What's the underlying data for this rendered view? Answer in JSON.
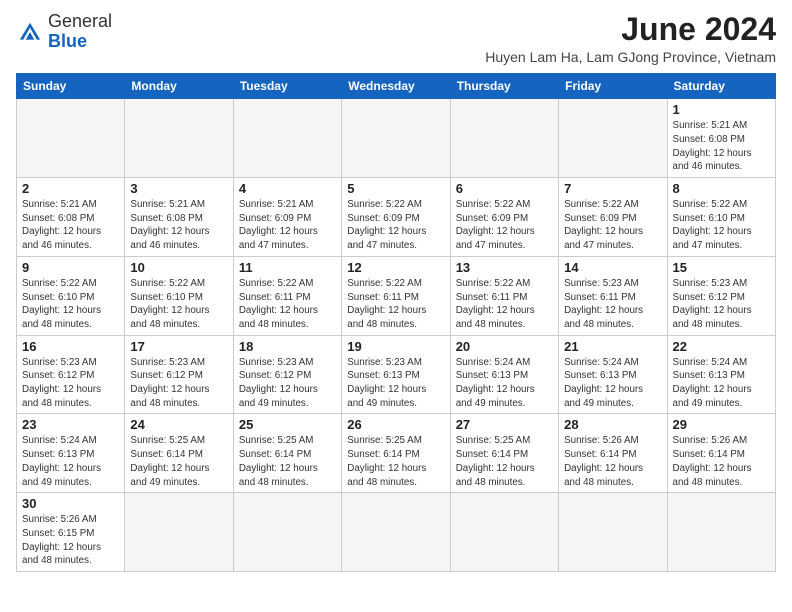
{
  "header": {
    "logo_general": "General",
    "logo_blue": "Blue",
    "month_title": "June 2024",
    "subtitle": "Huyen Lam Ha, Lam GJong Province, Vietnam"
  },
  "weekdays": [
    "Sunday",
    "Monday",
    "Tuesday",
    "Wednesday",
    "Thursday",
    "Friday",
    "Saturday"
  ],
  "weeks": [
    [
      {
        "day": "",
        "info": ""
      },
      {
        "day": "",
        "info": ""
      },
      {
        "day": "",
        "info": ""
      },
      {
        "day": "",
        "info": ""
      },
      {
        "day": "",
        "info": ""
      },
      {
        "day": "",
        "info": ""
      },
      {
        "day": "1",
        "info": "Sunrise: 5:21 AM\nSunset: 6:08 PM\nDaylight: 12 hours\nand 46 minutes."
      }
    ],
    [
      {
        "day": "2",
        "info": "Sunrise: 5:21 AM\nSunset: 6:08 PM\nDaylight: 12 hours\nand 46 minutes."
      },
      {
        "day": "3",
        "info": "Sunrise: 5:21 AM\nSunset: 6:08 PM\nDaylight: 12 hours\nand 46 minutes."
      },
      {
        "day": "4",
        "info": "Sunrise: 5:21 AM\nSunset: 6:09 PM\nDaylight: 12 hours\nand 47 minutes."
      },
      {
        "day": "5",
        "info": "Sunrise: 5:22 AM\nSunset: 6:09 PM\nDaylight: 12 hours\nand 47 minutes."
      },
      {
        "day": "6",
        "info": "Sunrise: 5:22 AM\nSunset: 6:09 PM\nDaylight: 12 hours\nand 47 minutes."
      },
      {
        "day": "7",
        "info": "Sunrise: 5:22 AM\nSunset: 6:09 PM\nDaylight: 12 hours\nand 47 minutes."
      },
      {
        "day": "8",
        "info": "Sunrise: 5:22 AM\nSunset: 6:10 PM\nDaylight: 12 hours\nand 47 minutes."
      }
    ],
    [
      {
        "day": "9",
        "info": "Sunrise: 5:22 AM\nSunset: 6:10 PM\nDaylight: 12 hours\nand 48 minutes."
      },
      {
        "day": "10",
        "info": "Sunrise: 5:22 AM\nSunset: 6:10 PM\nDaylight: 12 hours\nand 48 minutes."
      },
      {
        "day": "11",
        "info": "Sunrise: 5:22 AM\nSunset: 6:11 PM\nDaylight: 12 hours\nand 48 minutes."
      },
      {
        "day": "12",
        "info": "Sunrise: 5:22 AM\nSunset: 6:11 PM\nDaylight: 12 hours\nand 48 minutes."
      },
      {
        "day": "13",
        "info": "Sunrise: 5:22 AM\nSunset: 6:11 PM\nDaylight: 12 hours\nand 48 minutes."
      },
      {
        "day": "14",
        "info": "Sunrise: 5:23 AM\nSunset: 6:11 PM\nDaylight: 12 hours\nand 48 minutes."
      },
      {
        "day": "15",
        "info": "Sunrise: 5:23 AM\nSunset: 6:12 PM\nDaylight: 12 hours\nand 48 minutes."
      }
    ],
    [
      {
        "day": "16",
        "info": "Sunrise: 5:23 AM\nSunset: 6:12 PM\nDaylight: 12 hours\nand 48 minutes."
      },
      {
        "day": "17",
        "info": "Sunrise: 5:23 AM\nSunset: 6:12 PM\nDaylight: 12 hours\nand 48 minutes."
      },
      {
        "day": "18",
        "info": "Sunrise: 5:23 AM\nSunset: 6:12 PM\nDaylight: 12 hours\nand 49 minutes."
      },
      {
        "day": "19",
        "info": "Sunrise: 5:23 AM\nSunset: 6:13 PM\nDaylight: 12 hours\nand 49 minutes."
      },
      {
        "day": "20",
        "info": "Sunrise: 5:24 AM\nSunset: 6:13 PM\nDaylight: 12 hours\nand 49 minutes."
      },
      {
        "day": "21",
        "info": "Sunrise: 5:24 AM\nSunset: 6:13 PM\nDaylight: 12 hours\nand 49 minutes."
      },
      {
        "day": "22",
        "info": "Sunrise: 5:24 AM\nSunset: 6:13 PM\nDaylight: 12 hours\nand 49 minutes."
      }
    ],
    [
      {
        "day": "23",
        "info": "Sunrise: 5:24 AM\nSunset: 6:13 PM\nDaylight: 12 hours\nand 49 minutes."
      },
      {
        "day": "24",
        "info": "Sunrise: 5:25 AM\nSunset: 6:14 PM\nDaylight: 12 hours\nand 49 minutes."
      },
      {
        "day": "25",
        "info": "Sunrise: 5:25 AM\nSunset: 6:14 PM\nDaylight: 12 hours\nand 48 minutes."
      },
      {
        "day": "26",
        "info": "Sunrise: 5:25 AM\nSunset: 6:14 PM\nDaylight: 12 hours\nand 48 minutes."
      },
      {
        "day": "27",
        "info": "Sunrise: 5:25 AM\nSunset: 6:14 PM\nDaylight: 12 hours\nand 48 minutes."
      },
      {
        "day": "28",
        "info": "Sunrise: 5:26 AM\nSunset: 6:14 PM\nDaylight: 12 hours\nand 48 minutes."
      },
      {
        "day": "29",
        "info": "Sunrise: 5:26 AM\nSunset: 6:14 PM\nDaylight: 12 hours\nand 48 minutes."
      }
    ],
    [
      {
        "day": "30",
        "info": "Sunrise: 5:26 AM\nSunset: 6:15 PM\nDaylight: 12 hours\nand 48 minutes."
      },
      {
        "day": "",
        "info": ""
      },
      {
        "day": "",
        "info": ""
      },
      {
        "day": "",
        "info": ""
      },
      {
        "day": "",
        "info": ""
      },
      {
        "day": "",
        "info": ""
      },
      {
        "day": "",
        "info": ""
      }
    ]
  ]
}
